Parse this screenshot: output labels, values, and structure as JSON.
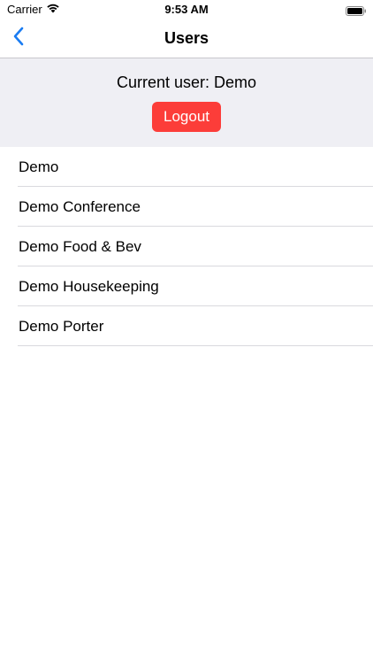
{
  "status_bar": {
    "carrier": "Carrier",
    "time": "9:53 AM",
    "wifi_icon": "wifi-icon",
    "battery_icon": "battery-icon"
  },
  "nav": {
    "title": "Users",
    "back_icon": "chevron-left-icon",
    "accent_color": "#1a7cf2"
  },
  "panel": {
    "current_user_text": "Current user: Demo",
    "logout_label": "Logout",
    "logout_color": "#fc3d39"
  },
  "users": [
    {
      "name": "Demo"
    },
    {
      "name": "Demo Conference"
    },
    {
      "name": "Demo Food & Bev"
    },
    {
      "name": "Demo Housekeeping"
    },
    {
      "name": "Demo Porter"
    }
  ]
}
